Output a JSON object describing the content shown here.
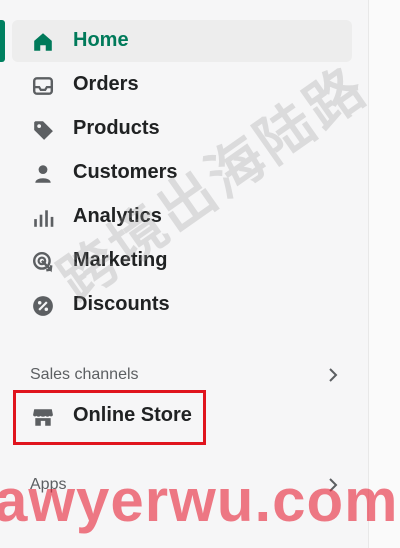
{
  "colors": {
    "accent": "#008060",
    "highlight_box": "#e0141e",
    "watermark_url": "#e6283c"
  },
  "nav": {
    "items": [
      {
        "label": "Home",
        "icon": "home-icon",
        "active": true
      },
      {
        "label": "Orders",
        "icon": "inbox-icon",
        "active": false
      },
      {
        "label": "Products",
        "icon": "tag-icon",
        "active": false
      },
      {
        "label": "Customers",
        "icon": "person-icon",
        "active": false
      },
      {
        "label": "Analytics",
        "icon": "bar-chart-icon",
        "active": false
      },
      {
        "label": "Marketing",
        "icon": "target-icon",
        "active": false
      },
      {
        "label": "Discounts",
        "icon": "discount-icon",
        "active": false
      }
    ]
  },
  "sales_channels": {
    "header": "Sales channels",
    "items": [
      {
        "label": "Online Store",
        "icon": "store-icon"
      }
    ]
  },
  "apps": {
    "header": "Apps"
  },
  "watermarks": {
    "chinese": "跨境出海陆路",
    "url": "awyerwu.com"
  }
}
